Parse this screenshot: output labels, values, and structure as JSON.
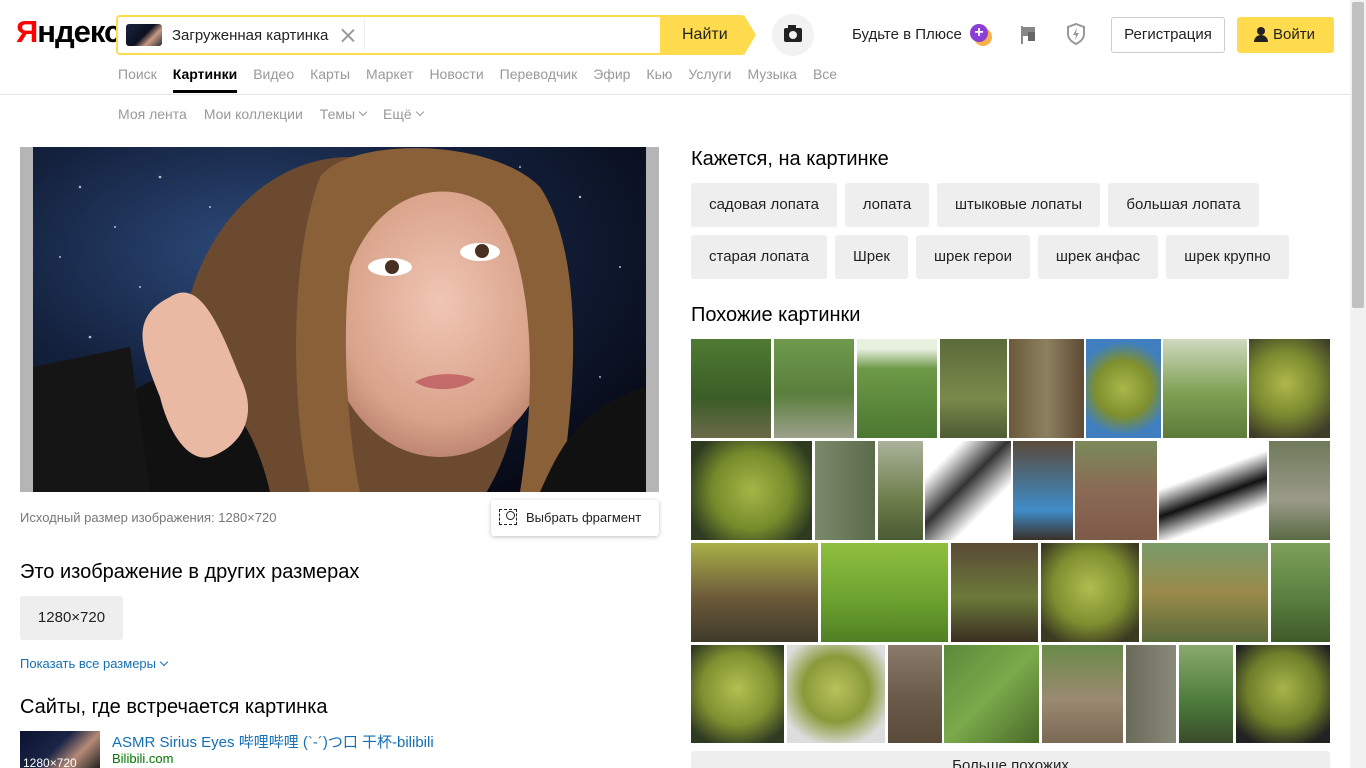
{
  "logo": {
    "first": "Я",
    "rest": "ндекс"
  },
  "search": {
    "chip_label": "Загруженная картинка",
    "button_label": "Найти"
  },
  "header": {
    "plus_label": "Будьте в Плюсе",
    "register_label": "Регистрация",
    "login_label": "Войти"
  },
  "services": [
    "Поиск",
    "Картинки",
    "Видео",
    "Карты",
    "Маркет",
    "Новости",
    "Переводчик",
    "Эфир",
    "Кью",
    "Услуги",
    "Музыка",
    "Все"
  ],
  "active_service": "Картинки",
  "subnav": {
    "feed": "Моя лента",
    "collections": "Мои коллекции",
    "themes": "Темы",
    "more": "Ещё"
  },
  "image_info": {
    "size_text": "Исходный размер изображения: 1280×720",
    "fragment_label": "Выбрать фрагмент"
  },
  "sizes": {
    "title": "Это изображение в других размерах",
    "chip": "1280×720",
    "show_all": "Показать все размеры"
  },
  "sites": {
    "title": "Сайты, где встречается картинка",
    "items": [
      {
        "title": "ASMR Sirius Eyes 哔哩哔哩 (`-´)つ口 干杯-bilibili",
        "host": "Bilibili.com",
        "thumb_label": "1280×720"
      }
    ]
  },
  "recognized": {
    "title": "Кажется, на картинке",
    "tags": [
      "садовая лопата",
      "лопата",
      "штыковые лопаты",
      "большая лопата",
      "старая лопата",
      "Шрек",
      "шрек герои",
      "шрек анфас",
      "шрек крупно"
    ]
  },
  "similar": {
    "title": "Похожие картинки",
    "more_label": "Больше похожих"
  },
  "colors": {
    "accent": "#ffdb4d",
    "link": "#146fb4",
    "host": "#007700",
    "logo_red": "#ff0000"
  }
}
